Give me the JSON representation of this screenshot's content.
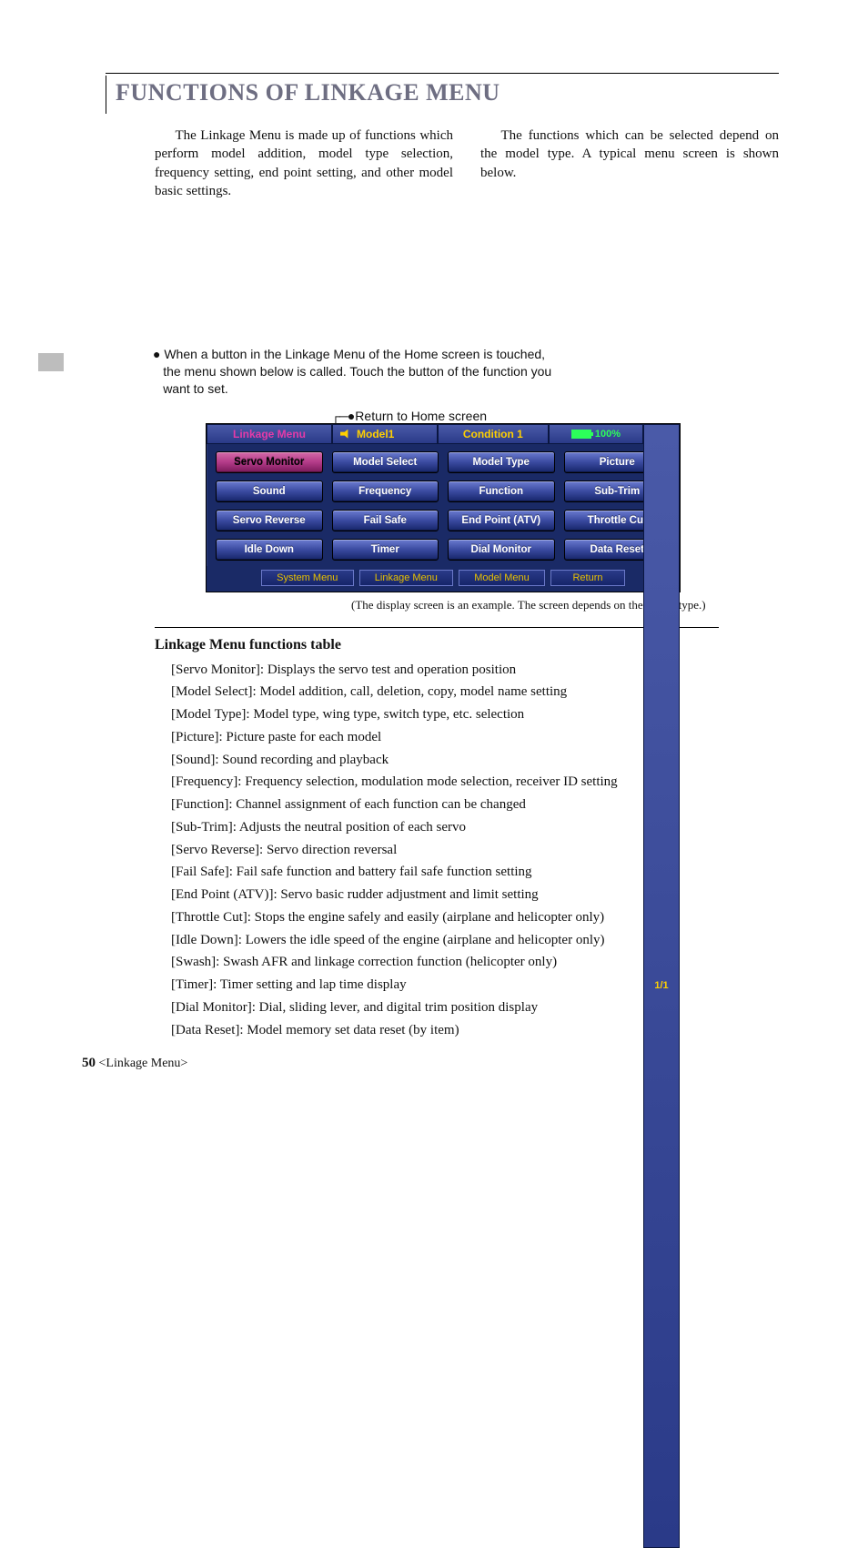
{
  "heading": "FUNCTIONS OF LINKAGE MENU",
  "intro": {
    "left": "The Linkage Menu is made up of functions which perform model addition, model type selection, frequency setting, end point setting, and other model basic settings.",
    "right": "The functions which can be selected depend on the model type. A typical menu screen is shown below."
  },
  "note": "● When a button in the Linkage Menu of the Home screen is touched, the menu shown below is called. Touch the button of the function you want to set.",
  "annotation": "●Return to Home screen",
  "annotation_dash": "┌─",
  "screen": {
    "title": "Linkage Menu",
    "model": "Model1",
    "condition": "Condition 1",
    "battery": "100%",
    "page": "1/1",
    "buttons": [
      "Servo Monitor",
      "Model Select",
      "Model Type",
      "Picture",
      "Sound",
      "Frequency",
      "Function",
      "Sub-Trim",
      "Servo Reverse",
      "Fail Safe",
      "End Point (ATV)",
      "Throttle Cut",
      "Idle Down",
      "Timer",
      "Dial Monitor",
      "Data Reset"
    ],
    "active_index": 0,
    "tabs": [
      "System Menu",
      "Linkage Menu",
      "Model Menu",
      "Return"
    ]
  },
  "caption": "(The display screen is an example. The screen depends on the model type.)",
  "subhead": "Linkage Menu functions table",
  "functions": [
    "[Servo Monitor]: Displays the servo test and operation position",
    "[Model Select]: Model addition, call, deletion, copy, model name setting",
    "[Model Type]: Model type, wing type, switch type, etc. selection",
    "[Picture]: Picture paste for each model",
    "[Sound]: Sound recording and playback",
    "[Frequency]: Frequency selection, modulation mode selection, receiver ID setting",
    "[Function]: Channel assignment of each function can be changed",
    "[Sub-Trim]: Adjusts the neutral position of each servo",
    "[Servo Reverse]: Servo direction reversal",
    "[Fail Safe]: Fail safe function and battery fail safe function setting",
    "[End Point (ATV)]: Servo basic rudder adjustment and limit setting",
    "[Throttle Cut]: Stops the engine safely and easily (airplane and helicopter only)",
    "[Idle Down]: Lowers the idle speed of the engine (airplane and helicopter only)",
    "[Swash]: Swash AFR and linkage correction function (helicopter only)",
    "[Timer]: Timer setting and lap time display",
    "[Dial Monitor]: Dial, sliding lever, and digital trim position display",
    "[Data Reset]: Model memory set data reset (by item)"
  ],
  "footer": {
    "page": "50",
    "section": "<Linkage Menu>"
  }
}
